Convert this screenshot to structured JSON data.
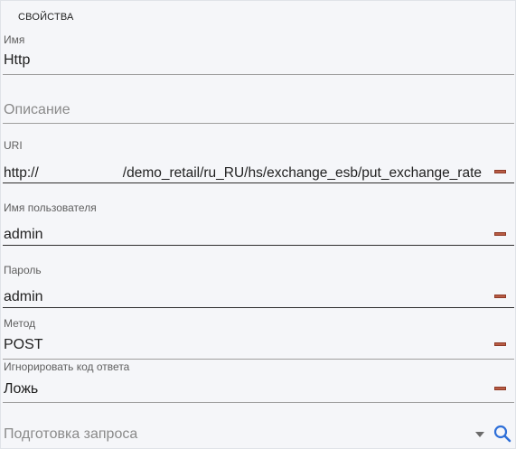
{
  "section": {
    "title": "СВОЙСТВА"
  },
  "fields": {
    "name": {
      "label": "Имя",
      "value": "Http"
    },
    "description": {
      "placeholder": "Описание"
    },
    "uri": {
      "label": "URI",
      "value_prefix": "http://",
      "value_suffix": "/demo_retail/ru_RU/hs/exchange_esb/put_exchange_rate"
    },
    "username": {
      "label": "Имя пользователя",
      "value": "admin"
    },
    "password": {
      "label": "Пароль",
      "value": "admin"
    },
    "method": {
      "label": "Метод",
      "value": "POST"
    },
    "ignore_code": {
      "label": "Игнорировать код ответа",
      "value": "Ложь"
    },
    "prepare_request": {
      "placeholder": "Подготовка запроса"
    }
  },
  "icons": {
    "clear": "minus-icon",
    "dropdown": "chevron-down-icon",
    "search": "search-icon"
  },
  "colors": {
    "clear_button": "#b85c45",
    "search_icon": "#2e6fd8"
  }
}
